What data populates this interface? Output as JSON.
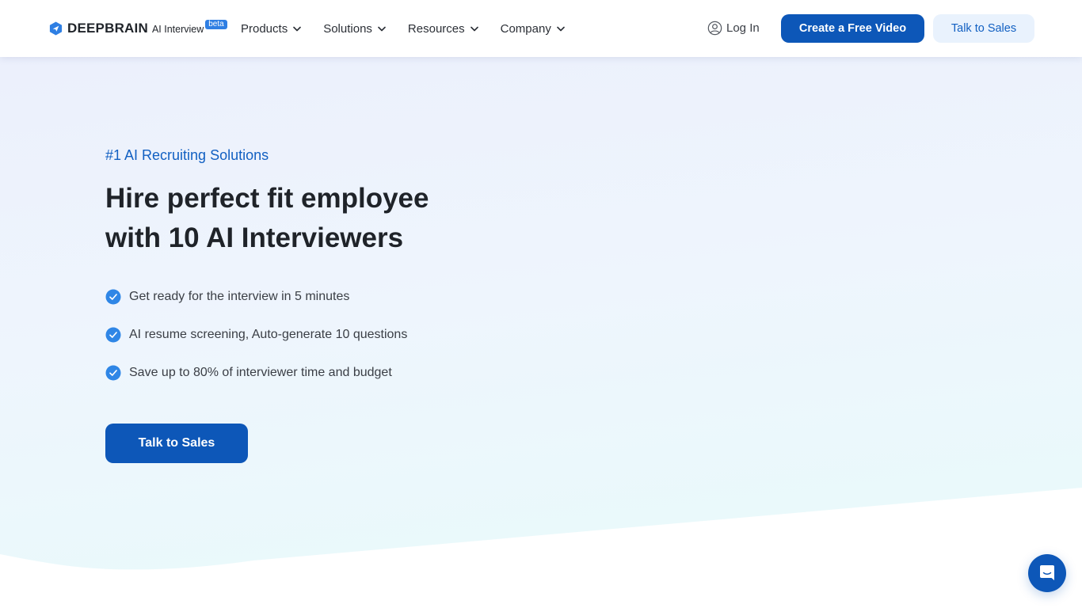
{
  "brand": {
    "name": "DEEPBRAIN",
    "product": "AI Interview",
    "badge": "beta",
    "colors": {
      "primary": "#0d57b8",
      "accent": "#2f7fe3",
      "accent_light": "#e9f2fd",
      "eyebrow": "#1260c2",
      "text_dark": "#1f2329"
    }
  },
  "nav": {
    "items": [
      {
        "label": "Products",
        "icon": "chevron-down-icon"
      },
      {
        "label": "Solutions",
        "icon": "chevron-down-icon"
      },
      {
        "label": "Resources",
        "icon": "chevron-down-icon"
      },
      {
        "label": "Company",
        "icon": "chevron-down-icon"
      }
    ],
    "login_label": "Log In",
    "login_icon": "user-circle-icon",
    "cta_primary": "Create a Free Video",
    "cta_secondary": "Talk to Sales"
  },
  "hero": {
    "eyebrow": "#1 AI Recruiting Solutions",
    "headline_line1": "Hire perfect fit employee",
    "headline_line2": "with 10 AI Interviewers",
    "features": [
      {
        "icon": "check-circle-icon",
        "text": "Get ready for the interview in 5 minutes"
      },
      {
        "icon": "check-circle-icon",
        "text": "AI resume screening, Auto-generate 10 questions"
      },
      {
        "icon": "check-circle-icon",
        "text": "Save up to 80% of interviewer time and budget"
      }
    ],
    "cta": "Talk to Sales"
  },
  "chat_widget": {
    "icon": "chat-bubble-icon"
  }
}
